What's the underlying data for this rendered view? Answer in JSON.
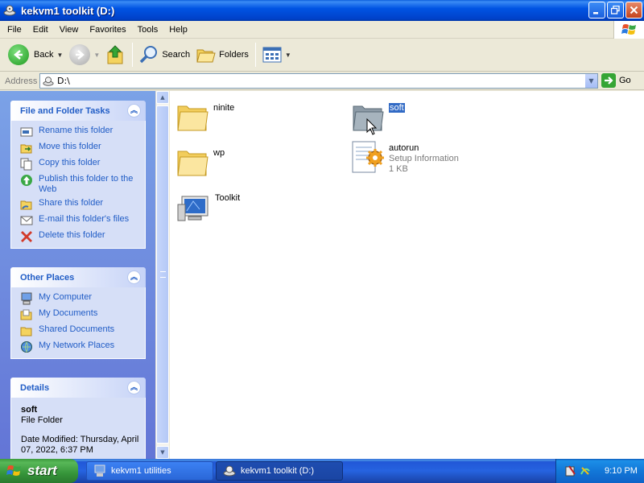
{
  "window": {
    "title": "kekvm1 toolkit (D:)",
    "buttons": [
      "minimize",
      "maximize",
      "close"
    ]
  },
  "menu": [
    "File",
    "Edit",
    "View",
    "Favorites",
    "Tools",
    "Help"
  ],
  "toolbar": {
    "back_label": "Back",
    "search_label": "Search",
    "folders_label": "Folders"
  },
  "address": {
    "label": "Address",
    "value": "D:\\",
    "go_label": "Go"
  },
  "tasks_panel": {
    "title": "File and Folder Tasks",
    "items": [
      {
        "label": "Rename this folder",
        "icon": "rename-icon"
      },
      {
        "label": "Move this folder",
        "icon": "move-icon"
      },
      {
        "label": "Copy this folder",
        "icon": "copy-icon"
      },
      {
        "label": "Publish this folder to the Web",
        "icon": "publish-web-icon"
      },
      {
        "label": "Share this folder",
        "icon": "share-icon"
      },
      {
        "label": "E-mail this folder's files",
        "icon": "email-icon"
      },
      {
        "label": "Delete this folder",
        "icon": "delete-icon"
      }
    ]
  },
  "places_panel": {
    "title": "Other Places",
    "items": [
      {
        "label": "My Computer",
        "icon": "my-computer-icon"
      },
      {
        "label": "My Documents",
        "icon": "my-documents-icon"
      },
      {
        "label": "Shared Documents",
        "icon": "shared-documents-icon"
      },
      {
        "label": "My Network Places",
        "icon": "network-places-icon"
      }
    ]
  },
  "details_panel": {
    "title": "Details",
    "name": "soft",
    "type": "File Folder",
    "modified": "Date Modified: Thursday, April 07, 2022, 6:37 PM"
  },
  "files": [
    {
      "name": "ninite",
      "kind": "folder"
    },
    {
      "name": "soft",
      "kind": "folder",
      "selected": true
    },
    {
      "name": "wp",
      "kind": "folder"
    },
    {
      "name": "autorun",
      "kind": "setup-info",
      "type": "Setup Information",
      "size": "1 KB"
    },
    {
      "name": "Toolkit",
      "kind": "application"
    }
  ],
  "taskbar": {
    "start_label": "start",
    "tasks": [
      {
        "label": "kekvm1 utilities",
        "active": false
      },
      {
        "label": "kekvm1 toolkit (D:)",
        "active": true
      }
    ],
    "clock": "9:10 PM"
  },
  "colors": {
    "titlebar": "#0054E3",
    "taskpane": "#7BA2E7",
    "link": "#215DC6",
    "selection": "#316AC5",
    "start": "#36953A"
  }
}
